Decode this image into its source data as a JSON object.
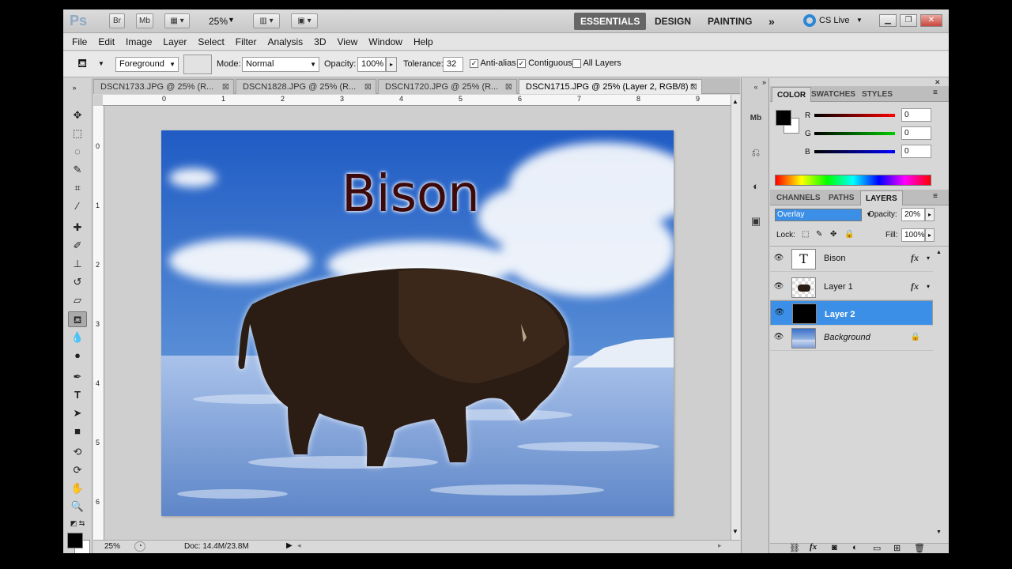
{
  "appbar": {
    "logo": "Ps",
    "bridge": "Br",
    "minibridge": "Mb",
    "zoom": "25%",
    "workspaces": [
      "ESSENTIALS",
      "DESIGN",
      "PAINTING"
    ],
    "more": "»",
    "cslive": "CS Live"
  },
  "menus": [
    "File",
    "Edit",
    "Image",
    "Layer",
    "Select",
    "Filter",
    "Analysis",
    "3D",
    "View",
    "Window",
    "Help"
  ],
  "options": {
    "fill_source": "Foreground",
    "mode_label": "Mode:",
    "mode_value": "Normal",
    "opacity_label": "Opacity:",
    "opacity_value": "100%",
    "tolerance_label": "Tolerance:",
    "tolerance_value": "32",
    "antialias": "Anti-alias",
    "contiguous": "Contiguous",
    "all_layers": "All Layers"
  },
  "doc_tabs": [
    {
      "label": "DSCN1733.JPG @ 25% (R...",
      "active": false
    },
    {
      "label": "DSCN1828.JPG @ 25% (R...",
      "active": false
    },
    {
      "label": "DSCN1720.JPG @ 25% (R...",
      "active": false
    },
    {
      "label": "DSCN1715.JPG @ 25% (Layer 2, RGB/8) *",
      "active": true
    }
  ],
  "rulers": {
    "h": [
      "0",
      "1",
      "2",
      "3",
      "4",
      "5",
      "6",
      "7",
      "8",
      "9"
    ],
    "v": [
      "0",
      "1",
      "2",
      "3",
      "4",
      "5",
      "6"
    ]
  },
  "canvas": {
    "text": "Bison"
  },
  "status": {
    "zoom": "25%",
    "doc": "Doc: 14.4M/23.8M"
  },
  "color_panel": {
    "tabs": [
      "COLOR",
      "SWATCHES",
      "STYLES"
    ],
    "r_label": "R",
    "g_label": "G",
    "b_label": "B",
    "r": "0",
    "g": "0",
    "b": "0",
    "foreground": "#000000"
  },
  "layers_panel": {
    "tabs": [
      "CHANNELS",
      "PATHS",
      "LAYERS"
    ],
    "blend_mode": "Overlay",
    "opacity_label": "Opacity:",
    "opacity": "20%",
    "lock_label": "Lock:",
    "fill_label": "Fill:",
    "fill": "100%",
    "layers": [
      {
        "name": "Bison",
        "type": "text",
        "fx": "fx"
      },
      {
        "name": "Layer 1",
        "type": "image",
        "fx": "fx"
      },
      {
        "name": "Layer 2",
        "type": "fill"
      },
      {
        "name": "Background",
        "type": "image"
      }
    ]
  },
  "colors": {
    "accent": "#3b8fe6",
    "text_color": "#3d0a0c"
  }
}
